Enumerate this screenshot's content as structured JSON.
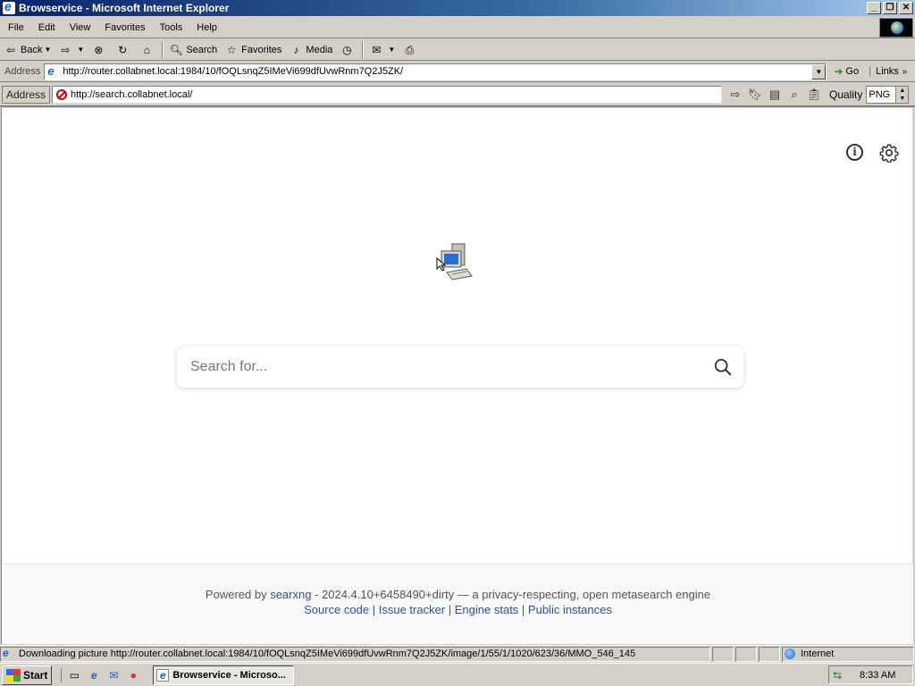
{
  "window": {
    "title": "Browservice - Microsoft Internet Explorer",
    "controls": [
      "_",
      "❐",
      "✕"
    ]
  },
  "menu": [
    "File",
    "Edit",
    "View",
    "Favorites",
    "Tools",
    "Help"
  ],
  "toolbar": {
    "back_label": "Back",
    "search_label": "Search",
    "favorites_label": "Favorites",
    "media_label": "Media"
  },
  "address_bar": {
    "label": "Address",
    "url": "http://router.collabnet.local:1984/10/fOQLsnqZ5IMeVi699dfUvwRnm7Q2J5ZK/",
    "go_label": "Go",
    "links_label": "Links"
  },
  "browservice_bar": {
    "label": "Address",
    "url": "http://search.collabnet.local/",
    "quality_label": "Quality",
    "quality_value": "PNG"
  },
  "page": {
    "search_placeholder": "Search for...",
    "footer": {
      "powered_by": "Powered by",
      "engine_name": "searxng",
      "version_text": " - 2024.4.10+6458490+dirty — a privacy-respecting, open metasearch engine",
      "links": [
        "Source code",
        "Issue tracker",
        "Engine stats",
        "Public instances"
      ],
      "separator": " | "
    }
  },
  "status_bar": {
    "message": "Downloading picture http://router.collabnet.local:1984/10/fOQLsnqZ5IMeVi699dfUvwRnm7Q2J5ZK/image/1/55/1/1020/623/36/MMO_546_145",
    "zone": "Internet"
  },
  "taskbar": {
    "start_label": "Start",
    "task_label": "Browservice - Microso...",
    "clock": "8:33 AM"
  },
  "colors": {
    "title_gradient_start": "#0a246a",
    "link": "#3050a0",
    "chrome": "#d4d0c8"
  }
}
